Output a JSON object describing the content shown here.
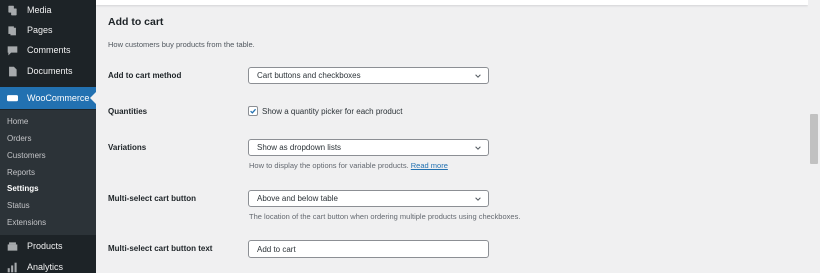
{
  "sidebar": {
    "top_items": [
      {
        "label": "Media",
        "icon": "media-icon"
      },
      {
        "label": "Pages",
        "icon": "pages-icon"
      },
      {
        "label": "Comments",
        "icon": "comments-icon"
      },
      {
        "label": "Documents",
        "icon": "documents-icon"
      }
    ],
    "woocommerce": {
      "label": "WooCommerce",
      "icon": "woocommerce-icon"
    },
    "submenu": [
      "Home",
      "Orders",
      "Customers",
      "Reports",
      "Settings",
      "Status",
      "Extensions"
    ],
    "current_submenu": "Settings",
    "bottom_items": [
      {
        "label": "Products",
        "icon": "products-icon"
      },
      {
        "label": "Analytics",
        "icon": "analytics-icon"
      }
    ]
  },
  "section": {
    "title": "Add to cart",
    "description": "How customers buy products from the table."
  },
  "fields": {
    "add_to_cart_method": {
      "label": "Add to cart method",
      "value": "Cart buttons and checkboxes"
    },
    "quantities": {
      "label": "Quantities",
      "checkbox_label": "Show a quantity picker for each product",
      "checked": true
    },
    "variations": {
      "label": "Variations",
      "value": "Show as dropdown lists",
      "help": "How to display the options for variable products.",
      "help_link": "Read more"
    },
    "multi_select_button": {
      "label": "Multi-select cart button",
      "value": "Above and below table",
      "help": "The location of the cart button when ordering multiple products using checkboxes."
    },
    "multi_select_button_text": {
      "label": "Multi-select cart button text",
      "value": "Add to cart"
    }
  },
  "colors": {
    "sidebar_bg": "#1d2327",
    "accent": "#2271b1",
    "submenu_bg": "#2c3338",
    "page_bg": "#f0f0f1"
  }
}
